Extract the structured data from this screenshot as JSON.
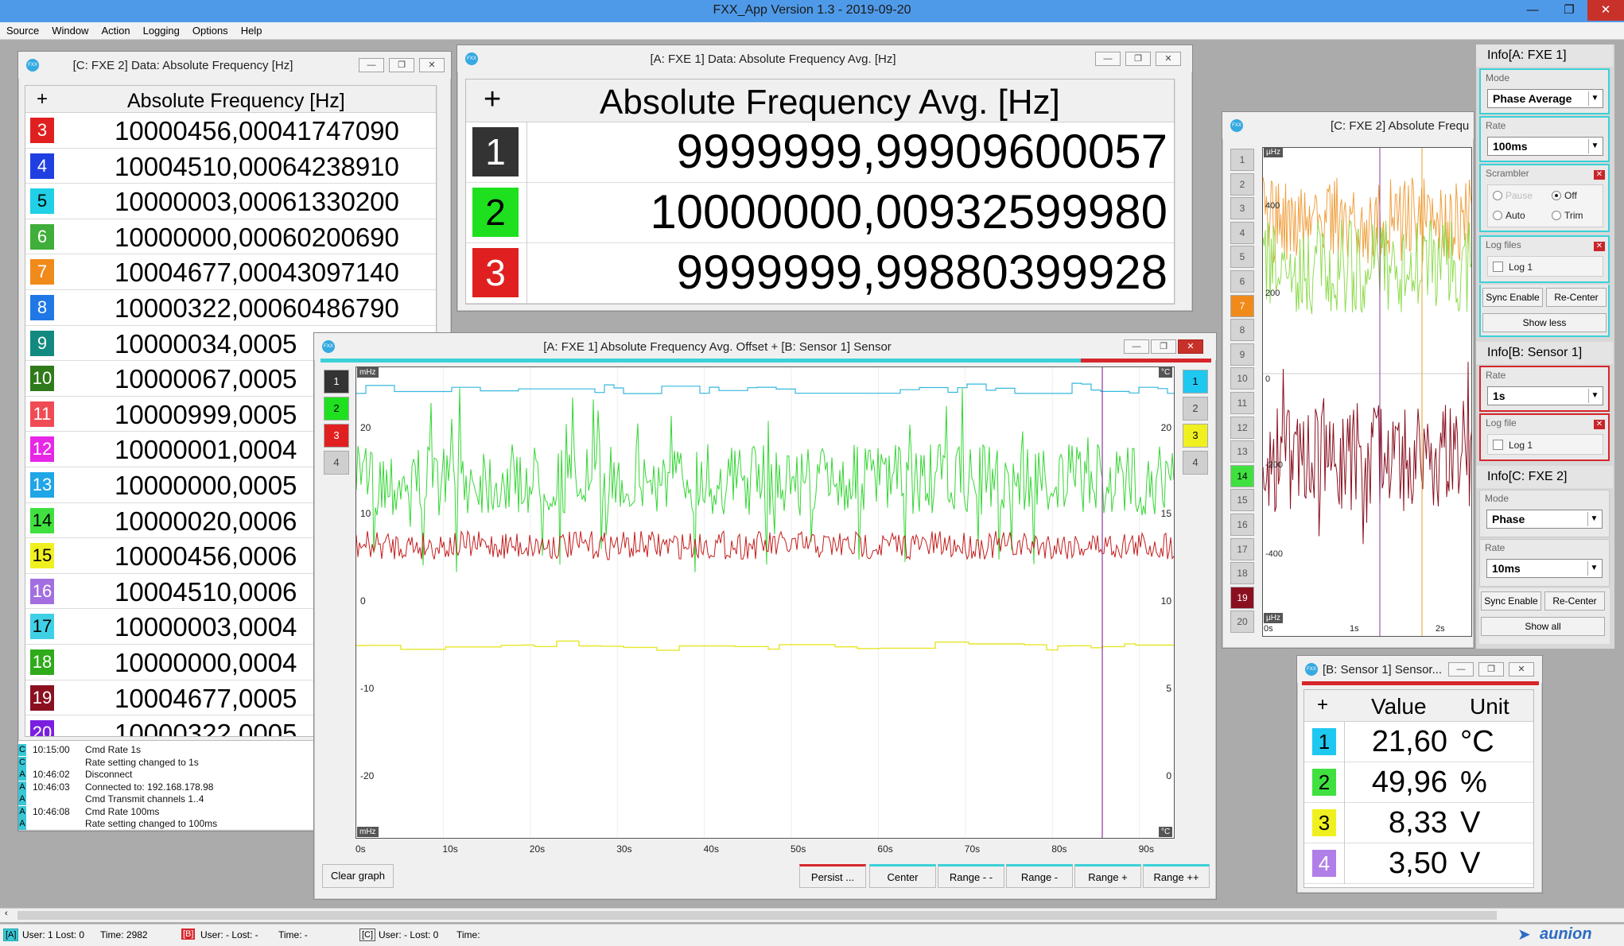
{
  "app": {
    "title": "FXX_App  Version 1.3 - 2019-09-20",
    "window_buttons": {
      "minimize": "—",
      "restore": "❐",
      "close": "✕"
    }
  },
  "menu": [
    "Source",
    "Window",
    "Action",
    "Logging",
    "Options",
    "Help"
  ],
  "win_c_data": {
    "title": "[C: FXE 2] Data: Absolute Frequency [Hz]",
    "header_plus": "+",
    "header_col": "Absolute Frequency [Hz]",
    "rows": [
      {
        "ch": "3",
        "color": "#e02020",
        "value": "10000456,00041747090"
      },
      {
        "ch": "4",
        "color": "#1f3fe0",
        "value": "10004510,00064238910"
      },
      {
        "ch": "5",
        "color": "#1fd0e6",
        "value": "10000003,00061330200"
      },
      {
        "ch": "6",
        "color": "#3fae3a",
        "value": "10000000,00060200690"
      },
      {
        "ch": "7",
        "color": "#f08a1a",
        "value": "10004677,00043097140"
      },
      {
        "ch": "8",
        "color": "#1f78e6",
        "value": "10000322,00060486790"
      },
      {
        "ch": "9",
        "color": "#138a7f",
        "value": "10000034,0005"
      },
      {
        "ch": "10",
        "color": "#2f7a1a",
        "value": "10000067,0005"
      },
      {
        "ch": "11",
        "color": "#f04b55",
        "value": "10000999,0005"
      },
      {
        "ch": "12",
        "color": "#e627e6",
        "value": "10000001,0004"
      },
      {
        "ch": "13",
        "color": "#1fa6e6",
        "value": "10000000,0005"
      },
      {
        "ch": "14",
        "color": "#3fe03f",
        "value": "10000020,0006"
      },
      {
        "ch": "15",
        "color": "#f0f020",
        "value": "10000456,0006"
      },
      {
        "ch": "16",
        "color": "#a36fe0",
        "value": "10004510,0006"
      },
      {
        "ch": "17",
        "color": "#3fd0e6",
        "value": "10000003,0004"
      },
      {
        "ch": "18",
        "color": "#2faa1a",
        "value": "10000000,0004"
      },
      {
        "ch": "19",
        "color": "#8a1020",
        "value": "10004677,0005"
      },
      {
        "ch": "20",
        "color": "#7a1fe0",
        "value": "10000322,0005"
      }
    ]
  },
  "win_a_data": {
    "title": "[A: FXE 1] Data: Absolute Frequency Avg. [Hz]",
    "header_plus": "+",
    "header_col": "Absolute Frequency Avg. [Hz]",
    "rows": [
      {
        "ch": "1",
        "color": "#333333",
        "value": "9999999,99909600057"
      },
      {
        "ch": "2",
        "color": "#1fe01f",
        "value": "10000000,00932599980"
      },
      {
        "ch": "3",
        "color": "#e02020",
        "value": "9999999,99880399928"
      }
    ]
  },
  "log": {
    "entries": [
      {
        "tag": "C",
        "time": "10:15:00",
        "text": "Cmd Rate 1s"
      },
      {
        "tag": "C",
        "time": "",
        "text": "Rate setting changed to 1s"
      },
      {
        "tag": "A",
        "time": "10:46:02",
        "text": "Disconnect"
      },
      {
        "tag": "A",
        "time": "10:46:03",
        "text": "Connected to: 192.168.178.98"
      },
      {
        "tag": "A",
        "time": "",
        "text": "Cmd Transmit channels 1..4"
      },
      {
        "tag": "A",
        "time": "10:46:08",
        "text": "Cmd Rate 100ms"
      },
      {
        "tag": "A",
        "time": "",
        "text": "Rate setting changed to 100ms"
      }
    ]
  },
  "graph_main": {
    "title": "[A: FXE 1] Absolute Frequency Avg. Offset + [B: Sensor 1] Sensor",
    "left_unit": "mHz",
    "right_unit": "°C",
    "bottom_left_unit": "mHz",
    "bottom_right_unit": "°C",
    "left_ticks": [
      "20",
      "10",
      "0",
      "-10",
      "-20"
    ],
    "right_ticks": [
      "20",
      "15",
      "10",
      "5",
      "0"
    ],
    "x_ticks": [
      "0s",
      "10s",
      "20s",
      "30s",
      "40s",
      "50s",
      "60s",
      "70s",
      "80s",
      "90s"
    ],
    "left_channels": [
      {
        "label": "1",
        "color": "#333333",
        "fg": "#ffffff"
      },
      {
        "label": "2",
        "color": "#1fe01f",
        "fg": "#000000"
      },
      {
        "label": "3",
        "color": "#e02020",
        "fg": "#ffffff"
      },
      {
        "label": "4",
        "color": "#cfcfcf",
        "fg": "#444444"
      }
    ],
    "right_channels": [
      {
        "label": "1",
        "color": "#1fc8f0",
        "fg": "#000000"
      },
      {
        "label": "2",
        "color": "#cfcfcf",
        "fg": "#444444"
      },
      {
        "label": "3",
        "color": "#f0f020",
        "fg": "#000000"
      },
      {
        "label": "4",
        "color": "#cfcfcf",
        "fg": "#444444"
      }
    ],
    "buttons": {
      "clear": "Clear graph",
      "persist": "Persist ...",
      "center": "Center",
      "range_mm": "Range - -",
      "range_m": "Range -",
      "range_p": "Range +",
      "range_pp": "Range ++"
    }
  },
  "graph_c": {
    "title": "[C: FXE 2] Absolute Frequ",
    "unit_top": "µHz",
    "unit_bottom": "µHz",
    "y_ticks": [
      "400",
      "200",
      "0",
      "-200",
      "-400"
    ],
    "x_ticks": [
      "0s",
      "1s",
      "2s"
    ],
    "channels": [
      {
        "label": "1"
      },
      {
        "label": "2"
      },
      {
        "label": "3"
      },
      {
        "label": "4"
      },
      {
        "label": "5"
      },
      {
        "label": "6"
      },
      {
        "label": "7",
        "color": "#f08a1a"
      },
      {
        "label": "8"
      },
      {
        "label": "9"
      },
      {
        "label": "10"
      },
      {
        "label": "11"
      },
      {
        "label": "12"
      },
      {
        "label": "13"
      },
      {
        "label": "14",
        "color": "#3fe03f"
      },
      {
        "label": "15"
      },
      {
        "label": "16"
      },
      {
        "label": "17"
      },
      {
        "label": "18"
      },
      {
        "label": "19",
        "color": "#8a1020"
      },
      {
        "label": "20"
      }
    ]
  },
  "info_a": {
    "title": "Info[A: FXE 1]",
    "mode_label": "Mode",
    "mode_value": "Phase Average",
    "rate_label": "Rate",
    "rate_value": "100ms",
    "scrambler_label": "Scrambler",
    "scr_opt1": "Pause",
    "scr_opt2": "Off",
    "scr_opt3": "Auto",
    "scr_opt4": "Trim",
    "logfiles_label": "Log files",
    "log_checkbox": "Log 1",
    "sync": "Sync Enable",
    "recenter": "Re-Center",
    "show_less": "Show less"
  },
  "info_b": {
    "title": "Info[B: Sensor 1]",
    "rate_label": "Rate",
    "rate_value": "1s",
    "logfile_label": "Log file",
    "log_checkbox": "Log 1"
  },
  "info_c": {
    "title": "Info[C: FXE 2]",
    "mode_label": "Mode",
    "mode_value": "Phase",
    "rate_label": "Rate",
    "rate_value": "10ms",
    "sync": "Sync Enable",
    "recenter": "Re-Center",
    "show_all": "Show all"
  },
  "sensor_win": {
    "title": "[B: Sensor 1] Sensor...",
    "header_plus": "+",
    "header_value": "Value",
    "header_unit": "Unit",
    "rows": [
      {
        "ch": "1",
        "color": "#1fc8f0",
        "fg": "#000000",
        "value": "21,60",
        "unit": "°C"
      },
      {
        "ch": "2",
        "color": "#3fe03f",
        "fg": "#000000",
        "value": "49,96",
        "unit": "%"
      },
      {
        "ch": "3",
        "color": "#f0f020",
        "fg": "#000000",
        "value": "8,33",
        "unit": "V"
      },
      {
        "ch": "4",
        "color": "#b07fe8",
        "fg": "#ffffff",
        "value": "3,50",
        "unit": "V"
      }
    ]
  },
  "statusbar": {
    "a_tag": "[A]",
    "a_text": "User: 1  Lost: 0",
    "a_time": "Time: 2982",
    "b_tag": "[B]",
    "b_text": "User: -  Lost: -",
    "b_time": "Time: -",
    "c_tag": "[C]",
    "c_text": "User: -  Lost: 0",
    "c_time": "Time:"
  },
  "logo": {
    "text": "aunion"
  },
  "colors": {
    "accent_cyan": "#3bd1d8",
    "accent_red": "#d6262b",
    "titlebar": "#4f9ae8"
  }
}
